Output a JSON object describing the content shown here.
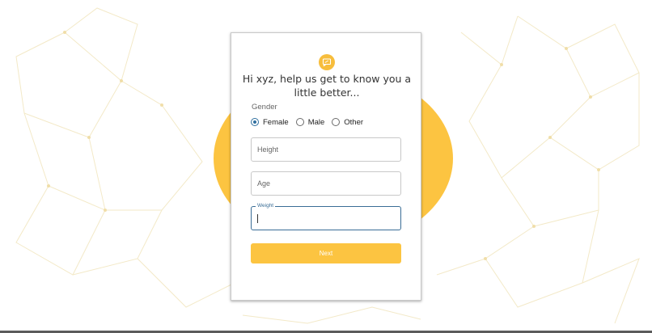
{
  "colors": {
    "accent": "#fcc441",
    "focus": "#3a6d96",
    "radio_checked": "#2f6f9f"
  },
  "header": {
    "logo_icon": "chat-bubble-icon",
    "title": "Hi xyz, help us get to know you a little better..."
  },
  "gender": {
    "label": "Gender",
    "selected": "Female",
    "options": [
      {
        "label": "Female",
        "checked": true
      },
      {
        "label": "Male",
        "checked": false
      },
      {
        "label": "Other",
        "checked": false
      }
    ]
  },
  "fields": {
    "height": {
      "placeholder": "Height",
      "value": ""
    },
    "age": {
      "placeholder": "Age",
      "value": ""
    },
    "weight": {
      "label": "Weight",
      "value": ""
    }
  },
  "actions": {
    "next_label": "Next"
  }
}
